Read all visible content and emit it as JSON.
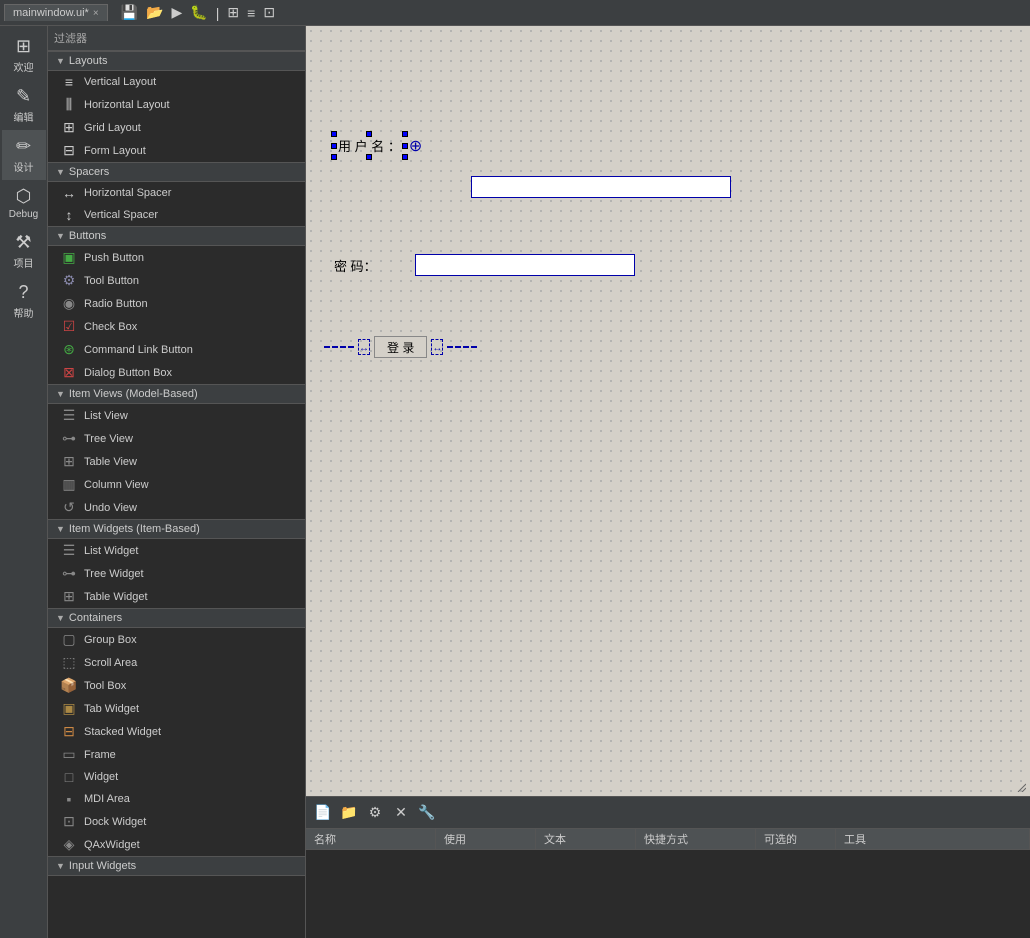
{
  "topbar": {
    "tab_label": "mainwindow.ui*",
    "close_label": "×"
  },
  "filter": {
    "label": "过滤器"
  },
  "sections": [
    {
      "key": "layouts",
      "label": "Layouts",
      "items": [
        {
          "icon": "≡",
          "label": "Vertical Layout"
        },
        {
          "icon": "⫼",
          "label": "Horizontal Layout"
        },
        {
          "icon": "⊞",
          "label": "Grid Layout"
        },
        {
          "icon": "⊟",
          "label": "Form Layout"
        }
      ]
    },
    {
      "key": "spacers",
      "label": "Spacers",
      "items": [
        {
          "icon": "↔",
          "label": "Horizontal Spacer"
        },
        {
          "icon": "↕",
          "label": "Vertical Spacer"
        }
      ]
    },
    {
      "key": "buttons",
      "label": "Buttons",
      "items": [
        {
          "icon": "▣",
          "label": "Push Button"
        },
        {
          "icon": "⚙",
          "label": "Tool Button"
        },
        {
          "icon": "◉",
          "label": "Radio Button"
        },
        {
          "icon": "☑",
          "label": "Check Box"
        },
        {
          "icon": "⊛",
          "label": "Command Link Button"
        },
        {
          "icon": "⊠",
          "label": "Dialog Button Box"
        }
      ]
    },
    {
      "key": "item_views",
      "label": "Item Views (Model-Based)",
      "items": [
        {
          "icon": "☰",
          "label": "List View"
        },
        {
          "icon": "⊶",
          "label": "Tree View"
        },
        {
          "icon": "⊞",
          "label": "Table View"
        },
        {
          "icon": "▥",
          "label": "Column View"
        },
        {
          "icon": "↺",
          "label": "Undo View"
        }
      ]
    },
    {
      "key": "item_widgets",
      "label": "Item Widgets (Item-Based)",
      "items": [
        {
          "icon": "☰",
          "label": "List Widget"
        },
        {
          "icon": "⊶",
          "label": "Tree Widget"
        },
        {
          "icon": "⊞",
          "label": "Table Widget"
        }
      ]
    },
    {
      "key": "containers",
      "label": "Containers",
      "items": [
        {
          "icon": "▢",
          "label": "Group Box"
        },
        {
          "icon": "⬚",
          "label": "Scroll Area"
        },
        {
          "icon": "🗂",
          "label": "Tool Box"
        },
        {
          "icon": "▣",
          "label": "Tab Widget"
        },
        {
          "icon": "⊟",
          "label": "Stacked Widget"
        },
        {
          "icon": "▭",
          "label": "Frame"
        },
        {
          "icon": "□",
          "label": "Widget"
        },
        {
          "icon": "▪",
          "label": "MDI Area"
        },
        {
          "icon": "⊡",
          "label": "Dock Widget"
        },
        {
          "icon": "◈",
          "label": "QAxWidget"
        }
      ]
    },
    {
      "key": "input_widgets",
      "label": "Input Widgets",
      "items": []
    }
  ],
  "left_sidebar": {
    "items": [
      {
        "icon": "⊞",
        "label": "欢迎"
      },
      {
        "icon": "✎",
        "label": "编辑"
      },
      {
        "icon": "✏",
        "label": "设计"
      },
      {
        "icon": "⬡",
        "label": "Debug"
      },
      {
        "icon": "⚒",
        "label": "项目"
      },
      {
        "icon": "?",
        "label": "帮助"
      }
    ]
  },
  "canvas": {
    "username_label": "用 户 名 ：",
    "password_label": "密 码：",
    "login_button": "登 录",
    "move_icon": "⊕"
  },
  "bottom_panel": {
    "icons": [
      "📄",
      "📁",
      "⚙",
      "✕",
      "🔧"
    ],
    "columns": [
      "名称",
      "使用",
      "文本",
      "快捷方式",
      "可选的",
      "工具"
    ]
  }
}
